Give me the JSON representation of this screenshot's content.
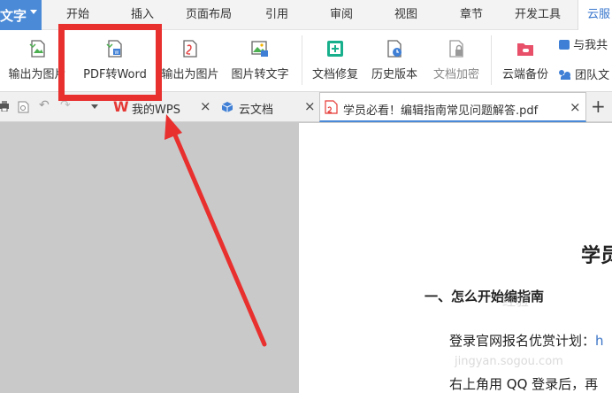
{
  "menu": {
    "app_label": "文字",
    "tabs": [
      "开始",
      "插入",
      "页面布局",
      "引用",
      "审阅",
      "视图",
      "章节",
      "开发工具",
      "云服"
    ]
  },
  "ribbon": {
    "buttons": [
      {
        "label": "输出为图片"
      },
      {
        "label": "PDF转Word"
      },
      {
        "label": "输出为图片"
      },
      {
        "label": "图片转文字"
      },
      {
        "label": "文档修复"
      },
      {
        "label": "历史版本"
      },
      {
        "label": "文档加密"
      },
      {
        "label": "云端备份"
      }
    ],
    "side_items": [
      "与我共",
      "团队文"
    ]
  },
  "doc_tabs": [
    {
      "label": "我的WPS",
      "close": "×"
    },
    {
      "label": "云文档",
      "close": "×"
    },
    {
      "label": "学员必看！编辑指南常见问题解答.pdf",
      "close": "×"
    }
  ],
  "new_tab": "+",
  "document": {
    "title": "学员",
    "heading": "一、怎么开始编指南",
    "line1": "登录官网报名优赏计划：",
    "line1_link": "h",
    "line2": "右上角用 QQ 登录后，再",
    "watermark1": "经验",
    "watermark2": "jingyan.sogou.com"
  },
  "colors": {
    "accent": "#4a8ad7",
    "highlight": "#e8302f"
  }
}
